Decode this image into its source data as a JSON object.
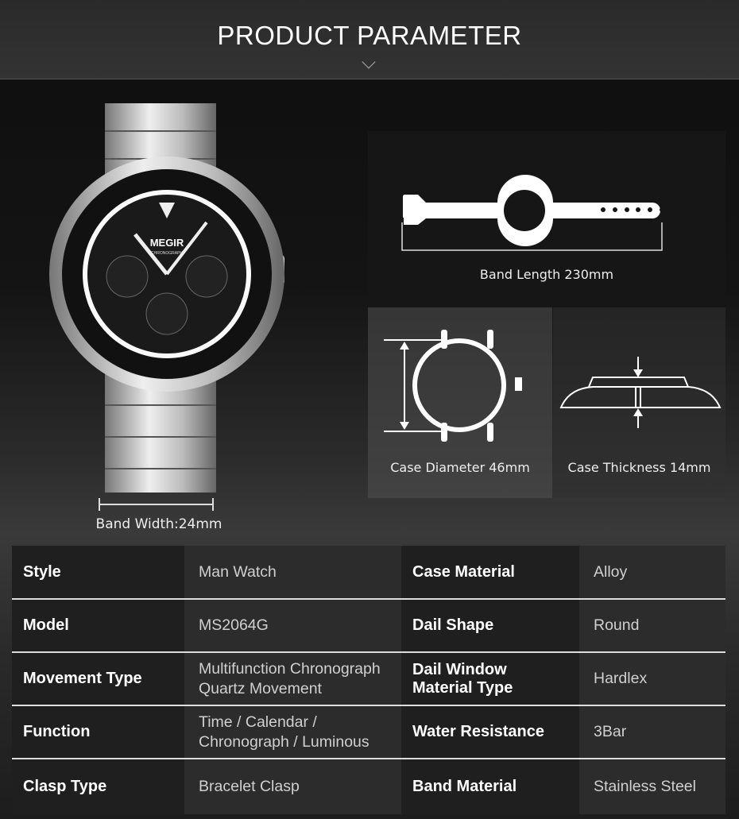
{
  "header": {
    "title": "PRODUCT PARAMETER"
  },
  "watch": {
    "logo": "MEGIR",
    "sublogo": "CHRONOGRAPH",
    "band_width_label": "Band Width:24mm"
  },
  "dimensions": {
    "band_length": "Band Length 230mm",
    "case_diameter": "Case Diameter 46mm",
    "case_thickness": "Case Thickness 14mm"
  },
  "specs": [
    {
      "k1": "Style",
      "v1": [
        "Man Watch"
      ],
      "k2": [
        "Case Material"
      ],
      "v2": "Alloy"
    },
    {
      "k1": "Model",
      "v1": [
        "MS2064G"
      ],
      "k2": [
        "Dail Shape"
      ],
      "v2": "Round"
    },
    {
      "k1": "Movement Type",
      "v1": [
        "Multifunction Chronograph",
        "Quartz Movement"
      ],
      "k2": [
        "Dail Window",
        "Material Type"
      ],
      "v2": "Hardlex"
    },
    {
      "k1": "Function",
      "v1": [
        "Time  / Calendar /",
        "Chronograph / Luminous"
      ],
      "k2": [
        "Water Resistance"
      ],
      "v2": "3Bar"
    },
    {
      "k1": "Clasp Type",
      "v1": [
        "Bracelet Clasp"
      ],
      "k2": [
        "Band Material"
      ],
      "v2": "Stainless Steel"
    }
  ]
}
